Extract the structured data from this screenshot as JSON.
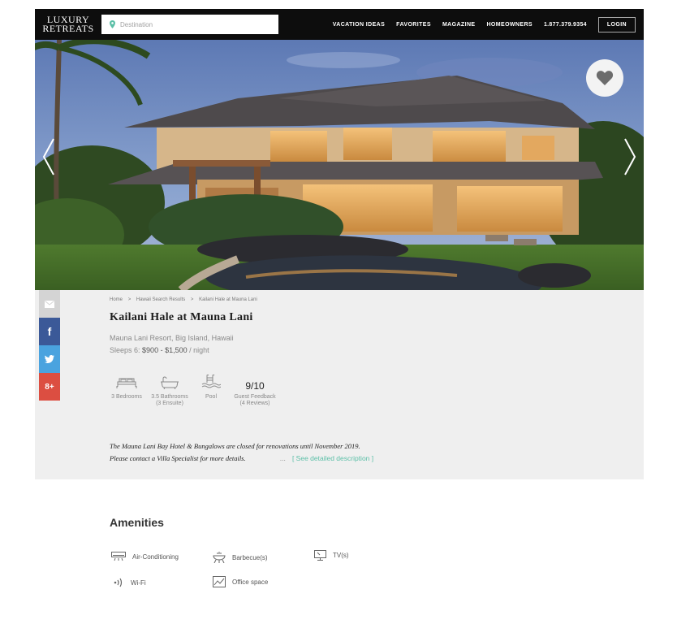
{
  "header": {
    "logo_line1": "LUXURY",
    "logo_line2": "RETREATS",
    "search_placeholder": "Destination",
    "nav": [
      "VACATION IDEAS",
      "FAVORITES",
      "MAGAZINE",
      "HOMEOWNERS"
    ],
    "phone": "1.877.379.9354",
    "login": "LOGIN"
  },
  "breadcrumb": [
    "Home",
    ">",
    "Hawaii Search Results",
    ">",
    "Kailani Hale at Mauna Lani"
  ],
  "property": {
    "title": "Kailani Hale at Mauna Lani",
    "location": "Mauna Lani Resort, Big Island, Hawaii",
    "sleeps": "Sleeps 6:",
    "price": "$900 - $1,500",
    "price_unit": "/ night"
  },
  "features": {
    "bedrooms": "3 Bedrooms",
    "bathrooms": "3.5 Bathrooms",
    "bathrooms_note": "(3 Ensuite)",
    "pool": "Pool",
    "rating": "9/10",
    "rating_label": "Guest Feedback",
    "rating_note": "(4 Reviews)"
  },
  "notice": {
    "line1": "The Mauna Lani Bay Hotel & Bungalows are closed for renovations until November 2019.",
    "line2": "Please contact a Villa Specialist for more details.",
    "more": "...",
    "link": "[ See detailed description ]"
  },
  "amenities": {
    "title": "Amenities",
    "items": [
      "Air-Conditioning",
      "Barbecue(s)",
      "TV(s)",
      "Wi-Fi",
      "Office space"
    ]
  },
  "colors": {
    "header_bg": "#0d0d0d",
    "panel_bg": "#efefef",
    "link": "#5bbfa7",
    "facebook": "#3b5998",
    "twitter": "#4aa3df",
    "google_plus": "#dc4e41"
  }
}
